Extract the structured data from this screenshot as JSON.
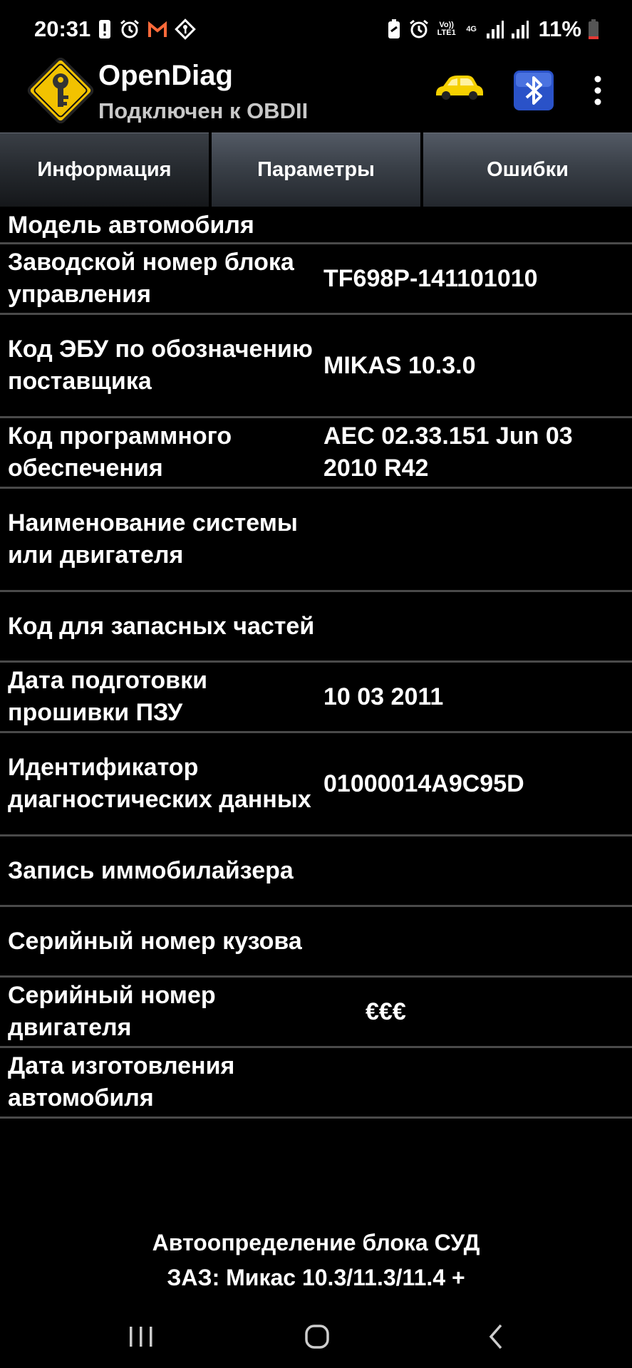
{
  "status_bar": {
    "time": "20:31",
    "battery_percent": "11%",
    "volte_label": "Vo)) LTE1",
    "network_label": "4G"
  },
  "app": {
    "title": "OpenDiag",
    "subtitle": "Подключен к OBDII"
  },
  "tabs": [
    {
      "label": "Информация",
      "active": true
    },
    {
      "label": "Параметры",
      "active": false
    },
    {
      "label": "Ошибки",
      "active": false
    }
  ],
  "info_rows": [
    {
      "label": "Модель автомобиля",
      "value": ""
    },
    {
      "label": "Заводской номер блока управления",
      "value": "TF698P-141101010"
    },
    {
      "label": "Код ЭБУ по обозначению поставщика",
      "value": "MIKAS 10.3.0"
    },
    {
      "label": "Код программного обеспечения",
      "value": "AEC 02.33.151  Jun 03 2010 R42"
    },
    {
      "label": "Наименование системы или двигателя",
      "value": ""
    },
    {
      "label": "Код для запасных частей",
      "value": ""
    },
    {
      "label": "Дата подготовки прошивки ПЗУ",
      "value": "10 03 2011"
    },
    {
      "label": "Идентификатор диагностических данных",
      "value": "01000014A9C95D"
    },
    {
      "label": "Запись иммобилайзера",
      "value": ""
    },
    {
      "label": "Серийный номер кузова",
      "value": ""
    },
    {
      "label": "Серийный номер двигателя",
      "value": "€€€"
    },
    {
      "label": "Дата изготовления автомобиля",
      "value": ""
    }
  ],
  "footer": {
    "line1": "Автоопределение блока СУД",
    "line2": "ЗАЗ: Микас 10.3/11.3/11.4 +"
  },
  "colors": {
    "background": "#000000",
    "divider": "#4a4a4a",
    "logo_yellow": "#f2c200",
    "car_yellow": "#f5d000",
    "bluetooth_blue": "#2a52c8"
  }
}
